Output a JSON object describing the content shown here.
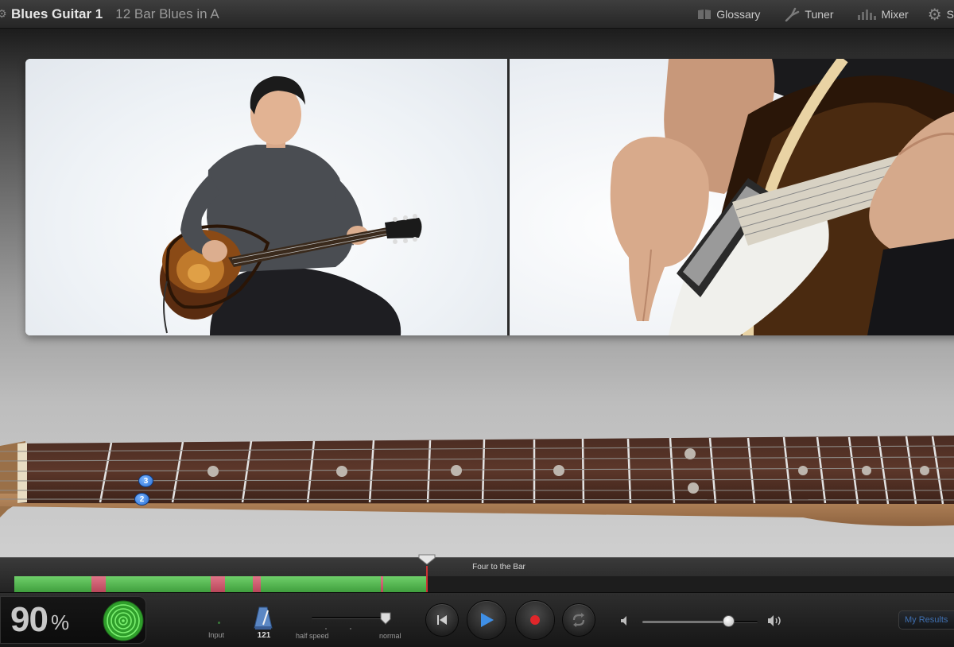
{
  "header": {
    "title": "Blues Guitar 1",
    "subtitle": "12 Bar Blues in A",
    "nav": [
      {
        "label": "Glossary",
        "icon": "book-icon"
      },
      {
        "label": "Tuner",
        "icon": "tuning-fork-icon"
      },
      {
        "label": "Mixer",
        "icon": "mixer-icon"
      },
      {
        "label": "S",
        "icon": "gear-icon"
      }
    ]
  },
  "video": {
    "left_view": "wide-shot",
    "right_view": "close-up"
  },
  "fretboard": {
    "finger_markers": [
      {
        "label": "3"
      },
      {
        "label": "2"
      }
    ]
  },
  "timeline": {
    "section_label": "Four to the Bar",
    "progress": 0.44,
    "miss_marks": [
      0.082,
      0.209,
      0.254,
      0.39
    ]
  },
  "controls": {
    "score_value": "90",
    "score_unit": "%",
    "input_label": "Input",
    "metronome_count": "121",
    "half_speed_label": "half speed",
    "normal_label": "normal",
    "speed_value": 1.0,
    "volume_value": 0.75,
    "results_label": "My Results"
  },
  "colors": {
    "progress_green": "#4fb34b",
    "miss_red": "#c8566b",
    "play_blue": "#3f8fe6",
    "record_red": "#e0262a",
    "score_ring": "#3fc03a"
  }
}
